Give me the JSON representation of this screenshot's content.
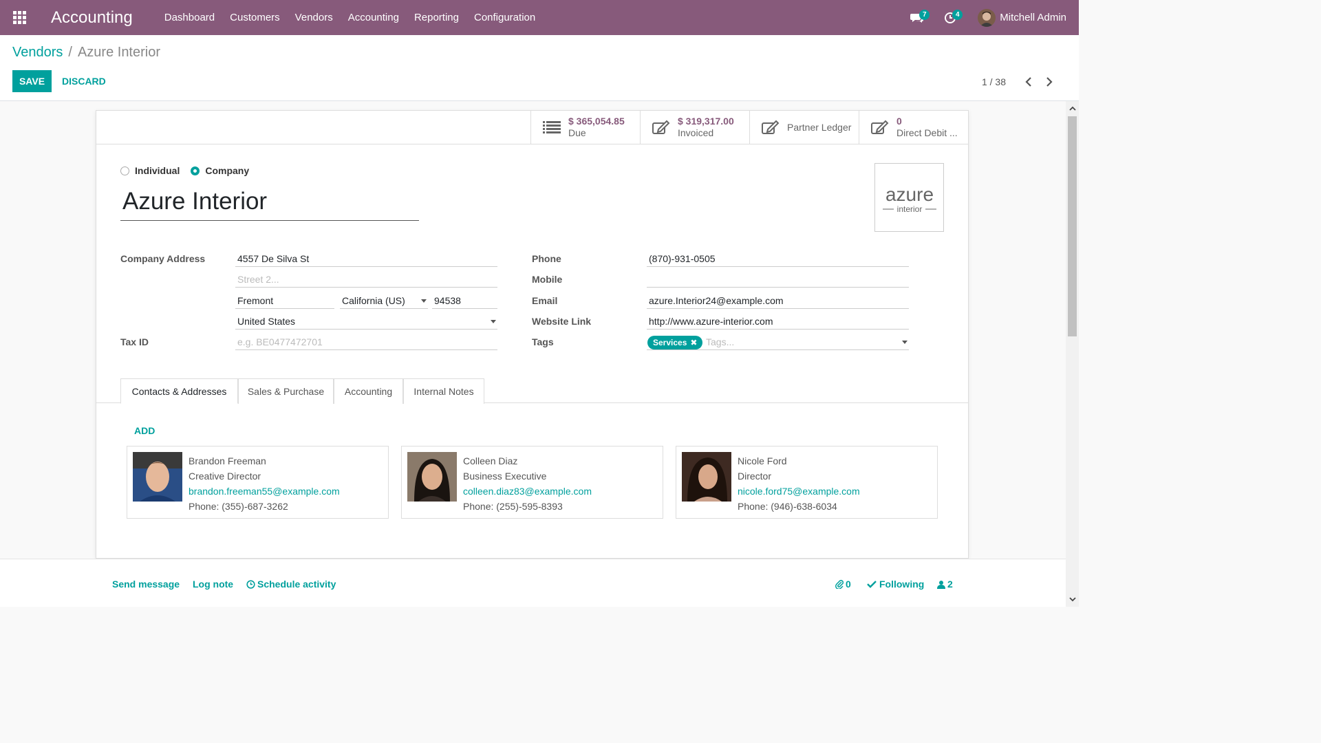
{
  "navbar": {
    "app_name": "Accounting",
    "menu": [
      "Dashboard",
      "Customers",
      "Vendors",
      "Accounting",
      "Reporting",
      "Configuration"
    ],
    "messages_count": "7",
    "activities_count": "4",
    "user_name": "Mitchell Admin",
    "color": "#875a7b"
  },
  "breadcrumb": {
    "parent": "Vendors",
    "current": "Azure Interior"
  },
  "actions": {
    "save_label": "SAVE",
    "discard_label": "DISCARD"
  },
  "pager": {
    "value": "1 / 38"
  },
  "stat_buttons": {
    "due_value": "$ 365,054.85",
    "due_label": "Due",
    "invoiced_value": "$ 319,317.00",
    "invoiced_label": "Invoiced",
    "ledger_label": "Partner Ledger",
    "debit_value": "0",
    "debit_label": "Direct Debit ..."
  },
  "company_type": {
    "individual_label": "Individual",
    "company_label": "Company",
    "selected": "Company"
  },
  "partner": {
    "name": "Azure Interior",
    "logo_text_main": "azure",
    "logo_text_sub": "interior"
  },
  "address": {
    "label": "Company Address",
    "street": "4557 De Silva St",
    "street2_placeholder": "Street 2...",
    "city": "Fremont",
    "state": "California (US)",
    "zip": "94538",
    "country": "United States"
  },
  "tax": {
    "label": "Tax ID",
    "placeholder": "e.g. BE0477472701"
  },
  "contact_info": {
    "phone_label": "Phone",
    "phone": "(870)-931-0505",
    "mobile_label": "Mobile",
    "mobile": "",
    "email_label": "Email",
    "email": "azure.Interior24@example.com",
    "website_label": "Website Link",
    "website": "http://www.azure-interior.com",
    "tags_label": "Tags",
    "tag": "Services",
    "tags_placeholder": "Tags..."
  },
  "tabs": [
    "Contacts & Addresses",
    "Sales & Purchase",
    "Accounting",
    "Internal Notes"
  ],
  "contacts": {
    "add_label": "ADD",
    "items": [
      {
        "name": "Brandon Freeman",
        "title": "Creative Director",
        "email": "brandon.freeman55@example.com",
        "phone": "Phone: (355)-687-3262"
      },
      {
        "name": "Colleen Diaz",
        "title": "Business Executive",
        "email": "colleen.diaz83@example.com",
        "phone": "Phone: (255)-595-8393"
      },
      {
        "name": "Nicole Ford",
        "title": "Director",
        "email": "nicole.ford75@example.com",
        "phone": "Phone: (946)-638-6034"
      }
    ]
  },
  "chatter": {
    "send_message": "Send message",
    "log_note": "Log note",
    "schedule_activity": "Schedule activity",
    "attachments_count": "0",
    "following": "Following",
    "followers_count": "2"
  },
  "colors": {
    "primary": "#875a7b",
    "accent": "#00a09d"
  }
}
